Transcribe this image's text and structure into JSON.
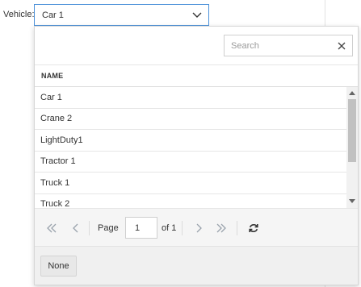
{
  "field": {
    "label": "Vehicle:",
    "selected": "Car 1"
  },
  "dropdown": {
    "search_placeholder": "Search",
    "column_header": "NAME",
    "items": [
      "Car 1",
      "Crane 2",
      "LightDuty1",
      "Tractor 1",
      "Truck 1",
      "Truck 2"
    ],
    "pager": {
      "page_label": "Page",
      "page_value": "1",
      "of_label": "of 1"
    },
    "none_button": "None"
  },
  "colors": {
    "focus_border": "#4a90d9",
    "icon_gray": "#9aa3ad",
    "refresh_icon": "#333333"
  },
  "icons": [
    "chevron-down-icon",
    "clear-icon",
    "first-page-icon",
    "prev-page-icon",
    "next-page-icon",
    "last-page-icon",
    "refresh-icon"
  ]
}
